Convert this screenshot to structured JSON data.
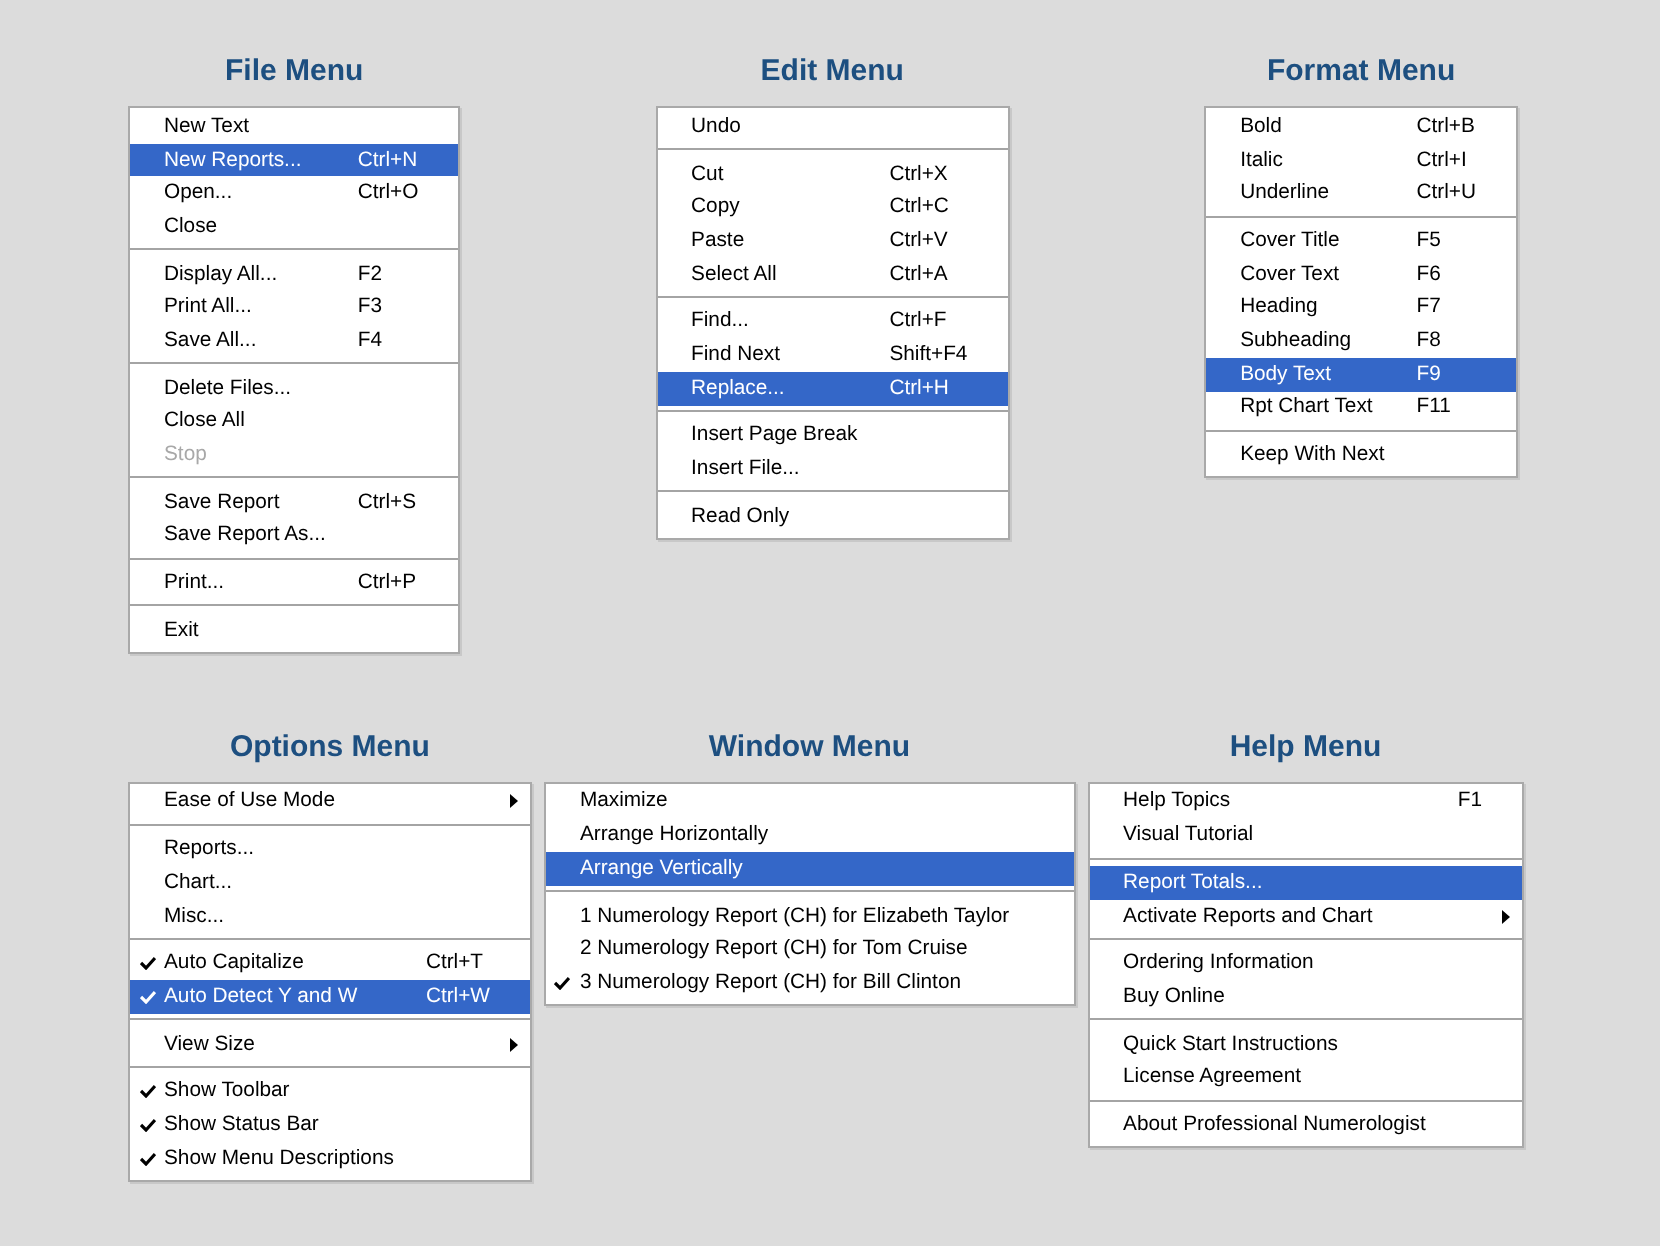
{
  "rows": [
    {
      "menus": [
        {
          "title": "File Menu",
          "items": [
            {
              "kind": "command",
              "label": "New Text",
              "selected": false,
              "disabled": false
            },
            {
              "kind": "command",
              "label": "New Reports...",
              "shortcut": "Ctrl+N",
              "selected": true,
              "disabled": false
            },
            {
              "kind": "command",
              "label": "Open...",
              "shortcut": "Ctrl+O",
              "selected": false,
              "disabled": false
            },
            {
              "kind": "command",
              "label": "Close",
              "selected": false,
              "disabled": false
            },
            {
              "kind": "separator"
            },
            {
              "kind": "command",
              "label": "Display All...",
              "shortcut": "F2",
              "selected": false,
              "disabled": false
            },
            {
              "kind": "command",
              "label": "Print All...",
              "shortcut": "F3",
              "selected": false,
              "disabled": false
            },
            {
              "kind": "command",
              "label": "Save All...",
              "shortcut": "F4",
              "selected": false,
              "disabled": false
            },
            {
              "kind": "separator"
            },
            {
              "kind": "command",
              "label": "Delete Files...",
              "selected": false,
              "disabled": false
            },
            {
              "kind": "command",
              "label": "Close All",
              "selected": false,
              "disabled": false
            },
            {
              "kind": "command",
              "label": "Stop",
              "selected": false,
              "disabled": true
            },
            {
              "kind": "separator"
            },
            {
              "kind": "command",
              "label": "Save Report",
              "shortcut": "Ctrl+S",
              "selected": false,
              "disabled": false
            },
            {
              "kind": "command",
              "label": "Save Report As...",
              "selected": false,
              "disabled": false
            },
            {
              "kind": "separator"
            },
            {
              "kind": "command",
              "label": "Print...",
              "shortcut": "Ctrl+P",
              "selected": false,
              "disabled": false
            },
            {
              "kind": "separator"
            },
            {
              "kind": "command",
              "label": "Exit",
              "selected": false,
              "disabled": false
            }
          ]
        },
        {
          "title": "Edit Menu",
          "items": [
            {
              "kind": "command",
              "label": "Undo",
              "selected": false
            },
            {
              "kind": "separator"
            },
            {
              "kind": "command",
              "label": "Cut",
              "shortcut": "Ctrl+X",
              "selected": false
            },
            {
              "kind": "command",
              "label": "Copy",
              "shortcut": "Ctrl+C",
              "selected": false
            },
            {
              "kind": "command",
              "label": "Paste",
              "shortcut": "Ctrl+V",
              "selected": false
            },
            {
              "kind": "command",
              "label": "Select All",
              "shortcut": "Ctrl+A",
              "selected": false
            },
            {
              "kind": "separator"
            },
            {
              "kind": "command",
              "label": "Find...",
              "shortcut": "Ctrl+F",
              "selected": false
            },
            {
              "kind": "command",
              "label": "Find Next",
              "shortcut": "Shift+F4",
              "selected": false
            },
            {
              "kind": "command",
              "label": "Replace...",
              "shortcut": "Ctrl+H",
              "selected": true
            },
            {
              "kind": "separator"
            },
            {
              "kind": "command",
              "label": "Insert Page Break",
              "selected": false
            },
            {
              "kind": "command",
              "label": "Insert File...",
              "selected": false
            },
            {
              "kind": "separator"
            },
            {
              "kind": "command",
              "label": "Read Only",
              "selected": false
            }
          ]
        },
        {
          "title": "Format Menu",
          "items": [
            {
              "kind": "command",
              "label": "Bold",
              "shortcut": "Ctrl+B",
              "selected": false
            },
            {
              "kind": "command",
              "label": "Italic",
              "shortcut": "Ctrl+I",
              "selected": false
            },
            {
              "kind": "command",
              "label": "Underline",
              "shortcut": "Ctrl+U",
              "selected": false
            },
            {
              "kind": "separator"
            },
            {
              "kind": "command",
              "label": "Cover Title",
              "shortcut": "F5",
              "selected": false
            },
            {
              "kind": "command",
              "label": "Cover Text",
              "shortcut": "F6",
              "selected": false
            },
            {
              "kind": "command",
              "label": "Heading",
              "shortcut": "F7",
              "selected": false
            },
            {
              "kind": "command",
              "label": "Subheading",
              "shortcut": "F8",
              "selected": false
            },
            {
              "kind": "command",
              "label": "Body Text",
              "shortcut": "F9",
              "selected": true
            },
            {
              "kind": "command",
              "label": "Rpt Chart Text",
              "shortcut": "F11",
              "selected": false
            },
            {
              "kind": "separator"
            },
            {
              "kind": "command",
              "label": "Keep With Next",
              "selected": false
            }
          ]
        }
      ]
    },
    {
      "menus": [
        {
          "title": "Options Menu",
          "items": [
            {
              "kind": "submenu",
              "label": "Ease of Use Mode",
              "selected": false,
              "checked": false
            },
            {
              "kind": "separator"
            },
            {
              "kind": "command",
              "label": "Reports...",
              "selected": false,
              "checked": false
            },
            {
              "kind": "command",
              "label": "Chart...",
              "selected": false,
              "checked": false
            },
            {
              "kind": "command",
              "label": "Misc...",
              "selected": false,
              "checked": false
            },
            {
              "kind": "separator"
            },
            {
              "kind": "command",
              "label": "Auto Capitalize",
              "shortcut": "Ctrl+T",
              "selected": false,
              "checked": true
            },
            {
              "kind": "command",
              "label": "Auto Detect Y and W",
              "shortcut": "Ctrl+W",
              "selected": true,
              "checked": true
            },
            {
              "kind": "separator"
            },
            {
              "kind": "submenu",
              "label": "View Size",
              "selected": false,
              "checked": false
            },
            {
              "kind": "separator"
            },
            {
              "kind": "command",
              "label": "Show Toolbar",
              "selected": false,
              "checked": true
            },
            {
              "kind": "command",
              "label": "Show Status Bar",
              "selected": false,
              "checked": true
            },
            {
              "kind": "command",
              "label": "Show Menu Descriptions",
              "selected": false,
              "checked": true
            }
          ]
        },
        {
          "title": "Window Menu",
          "items": [
            {
              "kind": "command",
              "label": "Maximize",
              "selected": false,
              "checked": false
            },
            {
              "kind": "command",
              "label": "Arrange Horizontally",
              "selected": false,
              "checked": false
            },
            {
              "kind": "command",
              "label": "Arrange Vertically",
              "selected": true,
              "checked": false
            },
            {
              "kind": "separator"
            },
            {
              "kind": "command",
              "label": "1 Numerology Report (CH) for Elizabeth Taylor",
              "selected": false,
              "checked": false
            },
            {
              "kind": "command",
              "label": "2 Numerology Report (CH) for Tom Cruise",
              "selected": false,
              "checked": false
            },
            {
              "kind": "command",
              "label": "3 Numerology Report (CH) for Bill Clinton",
              "selected": false,
              "checked": true
            }
          ]
        },
        {
          "title": "Help Menu",
          "items": [
            {
              "kind": "command",
              "label": "Help Topics",
              "shortcut": "F1",
              "selected": false
            },
            {
              "kind": "command",
              "label": "Visual Tutorial",
              "selected": false
            },
            {
              "kind": "separator"
            },
            {
              "kind": "command",
              "label": "Report Totals...",
              "selected": true
            },
            {
              "kind": "submenu",
              "label": "Activate Reports and Chart",
              "selected": false
            },
            {
              "kind": "separator"
            },
            {
              "kind": "command",
              "label": "Ordering Information",
              "selected": false
            },
            {
              "kind": "command",
              "label": "Buy Online",
              "selected": false
            },
            {
              "kind": "separator"
            },
            {
              "kind": "command",
              "label": "Quick Start Instructions",
              "selected": false
            },
            {
              "kind": "command",
              "label": "License Agreement",
              "selected": false
            },
            {
              "kind": "separator"
            },
            {
              "kind": "command",
              "label": "About Professional Numerologist",
              "selected": false
            }
          ]
        }
      ]
    }
  ]
}
